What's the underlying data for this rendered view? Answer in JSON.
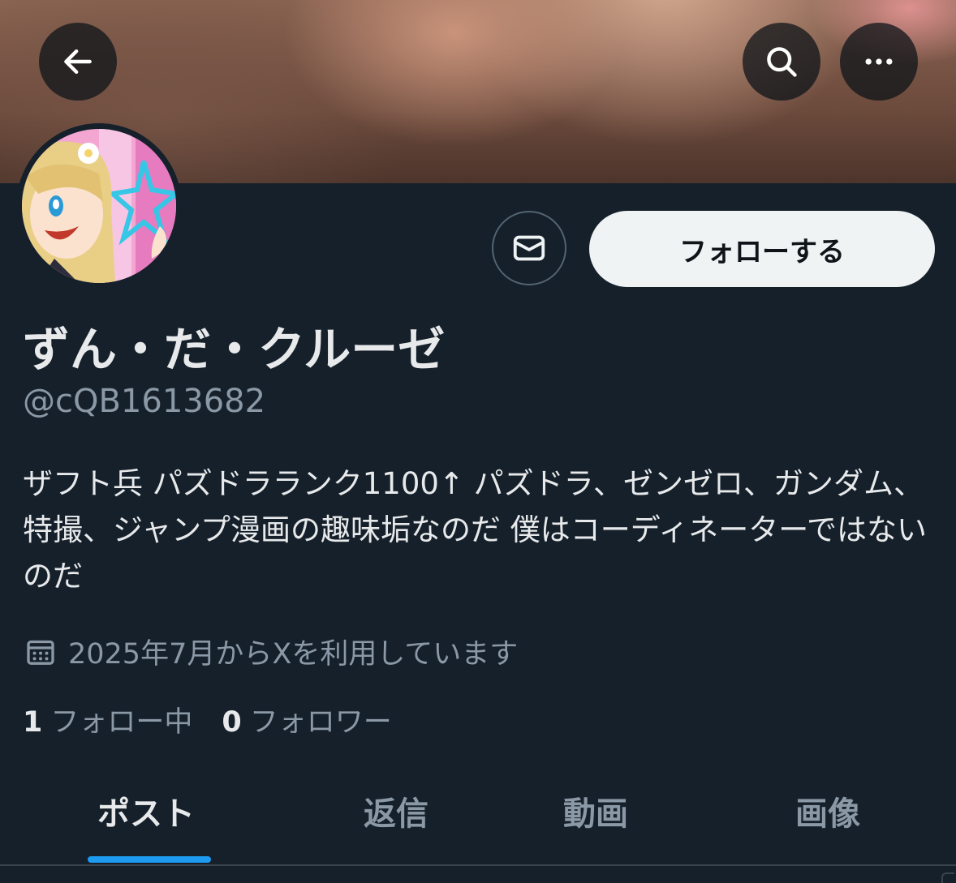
{
  "header": {
    "back_icon": "arrow-left-icon",
    "search_icon": "search-icon",
    "more_icon": "more-horizontal-icon"
  },
  "profile": {
    "display_name": "ずん・だ・クルーゼ",
    "handle": "@cQB1613682",
    "bio": "ザフト兵 パズドラランク1100↑ パズドラ、ゼンゼロ、ガンダム、特撮、ジャンプ漫画の趣味垢なのだ 僕はコーディネーターではないのだ",
    "joined": "2025年7月からXを利用しています",
    "following_count": "1",
    "following_label": "フォロー中",
    "followers_count": "0",
    "followers_label": "フォロワー"
  },
  "actions": {
    "message_icon": "mail-icon",
    "follow_label": "フォローする"
  },
  "tabs": [
    {
      "label": "ポスト",
      "active": true
    },
    {
      "label": "返信",
      "active": false
    },
    {
      "label": "動画",
      "active": false
    },
    {
      "label": "画像",
      "active": false
    }
  ],
  "colors": {
    "background": "#15202b",
    "accent": "#1d9bf0",
    "secondary_text": "#8b98a5",
    "primary_text": "#e7e9ea",
    "follow_button": "#eff3f4"
  }
}
